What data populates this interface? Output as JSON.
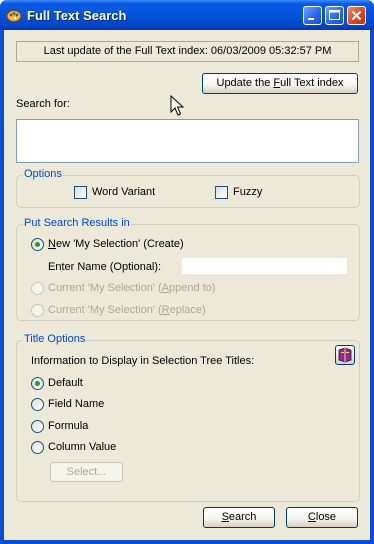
{
  "window": {
    "title": "Full Text Search",
    "icon": "app-icon"
  },
  "status": {
    "text": "Last update of the Full Text index: 06/03/2009 05:32:57 PM"
  },
  "update_button": {
    "label_pre": "Update the ",
    "label_u": "F",
    "label_post": "ull Text index"
  },
  "search": {
    "label": "Search for:",
    "value": ""
  },
  "options": {
    "legend": "Options",
    "word_variant": {
      "label": "Word Variant",
      "checked": false
    },
    "fuzzy": {
      "label": "Fuzzy",
      "checked": false
    }
  },
  "results": {
    "legend": "Put Search Results in",
    "new_selection": {
      "pre": "",
      "u": "N",
      "post": "ew 'My Selection' (Create)",
      "checked": true
    },
    "enter_name_label": "Enter Name (Optional):",
    "enter_name_value": "",
    "append": {
      "pre": "Current 'My Selection' (",
      "u": "A",
      "post": "ppend to)",
      "disabled": true
    },
    "replace": {
      "pre": "Current 'My Selection' (",
      "u": "R",
      "post": "eplace)",
      "disabled": true
    }
  },
  "title_options": {
    "legend": "Title Options",
    "info_label": "Information to Display in Selection Tree Titles:",
    "choices": [
      {
        "label": "Default",
        "checked": true
      },
      {
        "label": "Field Name",
        "checked": false
      },
      {
        "label": "Formula",
        "checked": false
      },
      {
        "label": "Column Value",
        "checked": false
      }
    ],
    "select_button": "Select..."
  },
  "footer": {
    "search_button": {
      "u": "S",
      "post": "earch"
    },
    "close_button": {
      "u": "C",
      "post": "lose"
    }
  },
  "colors": {
    "title_bar": "#0553da",
    "group_legend": "#0046d5",
    "radio_checked": "#21a121",
    "window_bg": "#ece9d8"
  }
}
